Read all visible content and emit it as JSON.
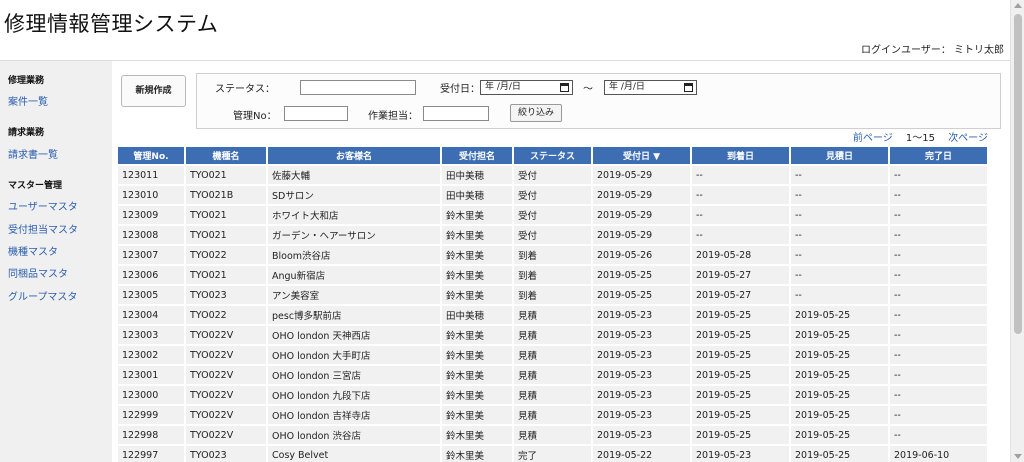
{
  "app": {
    "title": "修理情報管理システム"
  },
  "header": {
    "login_user": "ログインユーザー： ミトリ太郎"
  },
  "sidebar": {
    "sections": [
      {
        "heading": "修理業務",
        "items": [
          {
            "label": "案件一覧"
          }
        ]
      },
      {
        "heading": "請求業務",
        "items": [
          {
            "label": "請求書一覧"
          }
        ]
      },
      {
        "heading": "マスター管理",
        "items": [
          {
            "label": "ユーザーマスタ"
          },
          {
            "label": "受付担当マスタ"
          },
          {
            "label": "機種マスタ"
          },
          {
            "label": "同梱品マスタ"
          },
          {
            "label": "グループマスタ"
          }
        ]
      }
    ]
  },
  "toolbar": {
    "new_button": "新規作成"
  },
  "filter": {
    "status_label": "ステータス：",
    "status_value": "",
    "date_label": "受付日：",
    "date_from": "年 /月/日",
    "date_sep": "～",
    "date_to": "年 /月/日",
    "mgmt_label": "管理No：",
    "mgmt_value": "",
    "worker_label": "作業担当：",
    "worker_value": "",
    "submit": "絞り込み"
  },
  "pager": {
    "prev": "前ページ",
    "count": "1～15",
    "next": "次ページ"
  },
  "table": {
    "columns": [
      "管理No.",
      "機種名",
      "お客様名",
      "受付担名",
      "ステータス",
      "受付日 ▼",
      "到着日",
      "見積日",
      "完了日"
    ],
    "rows": [
      [
        "123011",
        "TYO021",
        "佐藤大輔",
        "田中美穂",
        "受付",
        "2019-05-29",
        "--",
        "--",
        "--"
      ],
      [
        "123010",
        "TYO021B",
        "SDサロン",
        "田中美穂",
        "受付",
        "2019-05-29",
        "--",
        "--",
        "--"
      ],
      [
        "123009",
        "TYO021",
        "ホワイト大和店",
        "鈴木里美",
        "受付",
        "2019-05-29",
        "--",
        "--",
        "--"
      ],
      [
        "123008",
        "TYO021",
        "ガーデン・ヘアーサロン",
        "鈴木里美",
        "受付",
        "2019-05-29",
        "--",
        "--",
        "--"
      ],
      [
        "123007",
        "TYO022",
        "Bloom渋谷店",
        "鈴木里美",
        "到着",
        "2019-05-26",
        "2019-05-28",
        "--",
        "--"
      ],
      [
        "123006",
        "TYO021",
        "Angu新宿店",
        "鈴木里美",
        "到着",
        "2019-05-25",
        "2019-05-27",
        "--",
        "--"
      ],
      [
        "123005",
        "TYO023",
        "アン美容室",
        "鈴木里美",
        "到着",
        "2019-05-25",
        "2019-05-27",
        "--",
        "--"
      ],
      [
        "123004",
        "TYO022",
        "pesc博多駅前店",
        "田中美穂",
        "見積",
        "2019-05-23",
        "2019-05-25",
        "2019-05-25",
        "--"
      ],
      [
        "123003",
        "TYO022V",
        "OHO london 天神西店",
        "鈴木里美",
        "見積",
        "2019-05-23",
        "2019-05-25",
        "2019-05-25",
        "--"
      ],
      [
        "123002",
        "TYO022V",
        "OHO london 大手町店",
        "鈴木里美",
        "見積",
        "2019-05-23",
        "2019-05-25",
        "2019-05-25",
        "--"
      ],
      [
        "123001",
        "TYO022V",
        "OHO london 三宮店",
        "鈴木里美",
        "見積",
        "2019-05-23",
        "2019-05-25",
        "2019-05-25",
        "--"
      ],
      [
        "123000",
        "TYO022V",
        "OHO london 九段下店",
        "鈴木里美",
        "見積",
        "2019-05-23",
        "2019-05-25",
        "2019-05-25",
        "--"
      ],
      [
        "122999",
        "TYO022V",
        "OHO london 吉祥寺店",
        "鈴木里美",
        "見積",
        "2019-05-23",
        "2019-05-25",
        "2019-05-25",
        "--"
      ],
      [
        "122998",
        "TYO022V",
        "OHO london 渋谷店",
        "鈴木里美",
        "見積",
        "2019-05-23",
        "2019-05-25",
        "2019-05-25",
        "--"
      ],
      [
        "122997",
        "TYO023",
        "Cosy Belvet",
        "鈴木里美",
        "完了",
        "2019-05-22",
        "2019-05-23",
        "2019-05-25",
        "2019-06-10"
      ]
    ]
  },
  "colors": {
    "header_bg": "#3d6eb4",
    "link": "#2a5db0",
    "sidebar_bg": "#f0f0f0",
    "cell_bg": "#f1f1f1"
  },
  "icons": {
    "date_picker": "calendar-icon",
    "sort": "sort-desc-icon"
  }
}
